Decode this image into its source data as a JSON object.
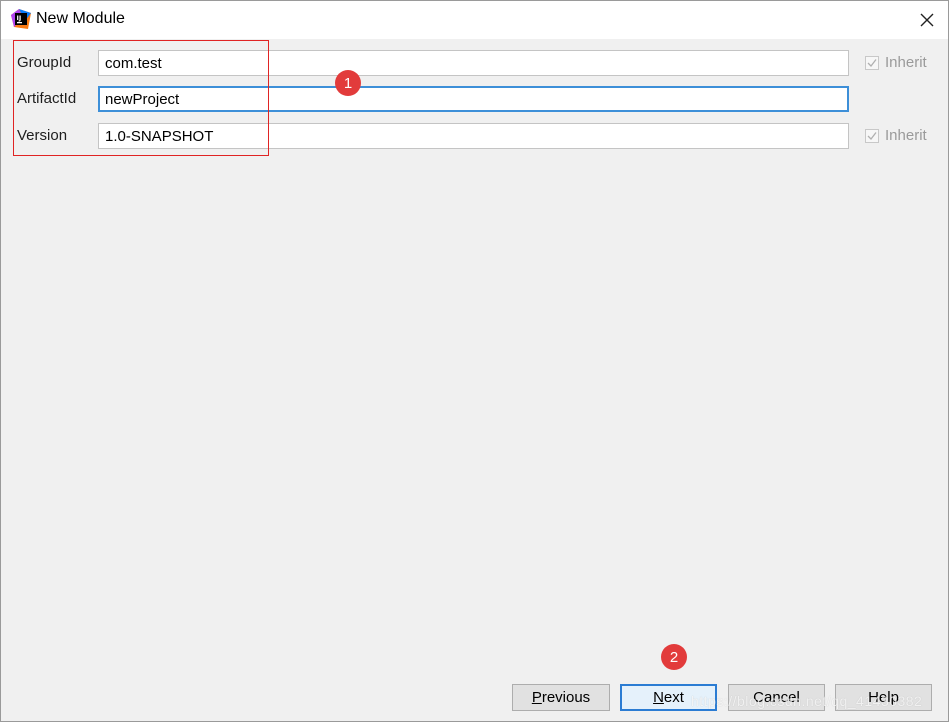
{
  "window": {
    "title": "New Module"
  },
  "form": {
    "group_id": {
      "label": "GroupId",
      "value": "com.test"
    },
    "artifact_id": {
      "label": "ArtifactId",
      "value": "newProject"
    },
    "version": {
      "label": "Version",
      "value": "1.0-SNAPSHOT"
    },
    "inherit_label": "Inherit",
    "group_inherit_checked": true,
    "version_inherit_checked": true
  },
  "annotations": {
    "badge_1": "1",
    "badge_2": "2"
  },
  "buttons": {
    "previous": {
      "mnemonic": "P",
      "rest": "revious"
    },
    "next": {
      "mnemonic": "N",
      "rest": "ext"
    },
    "cancel": "Cancel",
    "help": "Help"
  },
  "watermark": "https://blog.csdn.net/qq_41430382",
  "colors": {
    "accent": "#3d8fd8",
    "annotation": "#e02424"
  }
}
